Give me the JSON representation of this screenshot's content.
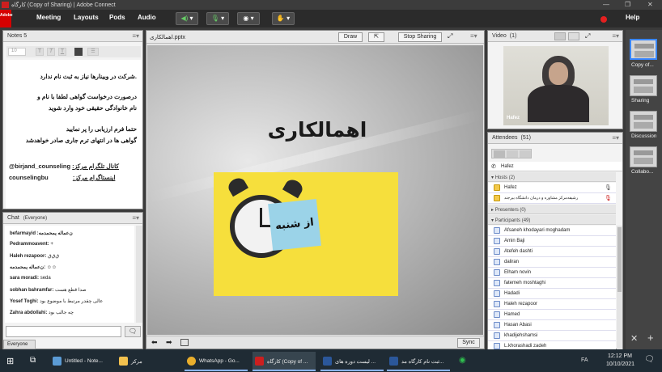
{
  "window": {
    "title": "کارگاه (Copy of Sharing) | Adobe Connect"
  },
  "adobe_logo": "Adobe",
  "menu": {
    "items": [
      "Meeting",
      "Layouts",
      "Pods",
      "Audio"
    ],
    "help": "Help"
  },
  "notes": {
    "title": "Notes 5",
    "font_size": "10",
    "lines": [
      ".شرکت در وبینارها نیاز به ثبت نام ندارد",
      "درصورت درخواست گواهی لطفا با نام و",
      "نام خانوادگی حقیقی خود وارد شوید",
      "حتما فرم ارزیابی را پر نمایید",
      "گواهی ها در انتهای ترم جاری صادر خواهدشد"
    ],
    "telegram_handle": "@birjand_counseling",
    "telegram_label": ":کانال تلگرام مرکز",
    "instagram_handle": "counselingbu",
    "instagram_label": ":اینستاگرام مرکز"
  },
  "chat": {
    "title": "Chat",
    "scope": "(Everyone)",
    "messages": [
      {
        "name": "befarmayid :ن‌عماله یمحمدمه",
        "text": ""
      },
      {
        "name": "Pedrammoavent:",
        "text": "+"
      },
      {
        "name": "Haleh rezapoor:",
        "text": "ق‌ق‌ق"
      },
      {
        "name": "ن‌عماله یمحمدمه:",
        "text": "☺☺"
      },
      {
        "name": "sara moradi:",
        "text": "seda"
      },
      {
        "name": "sobhan bahramfar:",
        "text": "صدا قطع هست"
      },
      {
        "name": "Yosef Toghi:",
        "text": "عالی چقدر مرتبط با موضوع بود"
      },
      {
        "name": "Zahra abdollahi:",
        "text": "چه جالب بود"
      }
    ],
    "recipient": "Everyone"
  },
  "share": {
    "title": "اهمالکاری.pptx",
    "draw_label": "Draw",
    "stop_label": "Stop Sharing",
    "slide_title": "اهمالکاری",
    "note_text": "از شنبه",
    "sync_label": "Sync"
  },
  "video": {
    "title": "Video",
    "count": "(1)",
    "participant": "Hafez"
  },
  "attendees": {
    "title": "Attendees",
    "count": "(51)",
    "me": "Hafez",
    "hosts_label": "Hosts (2)",
    "hosts": [
      "Hafez",
      "رشیفه‌مرکز مشاوره و درمان دانشگاه بیرجند"
    ],
    "presenters_label": "Presenters (0)",
    "participants_label": "Participants (49)",
    "participants": [
      "Afsaneh khodayari moghadam",
      "Amin Baji",
      "Atefeh dashti",
      "daliran",
      "Elham novin",
      "fatemeh moshtaghi",
      "Hadadi",
      "Haleh rezapoor",
      "Hamed",
      "Hasan Abasi",
      "khadijehshamsi",
      "L.khorashadi zadeh"
    ]
  },
  "layouts": [
    "Copy of...",
    "Sharing",
    "Discussion",
    "Collabo..."
  ],
  "taskbar": {
    "items": [
      "Untitled - Note...",
      "مرکز",
      "WhatsApp - Go...",
      "کارگاه (Copy of ...",
      "لیست دوره های ...",
      "ثبت نام کارگاه مد..."
    ],
    "time": "12:12 PM",
    "date": "10/10/2021",
    "lang": "FA"
  }
}
